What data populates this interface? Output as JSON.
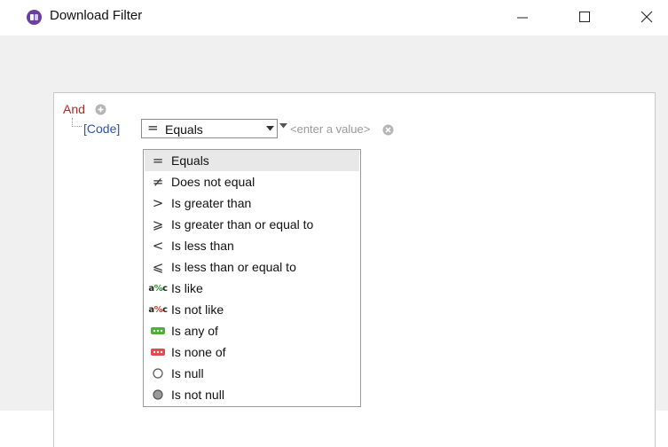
{
  "window": {
    "title": "Download Filter",
    "icon": "app-icon"
  },
  "filter": {
    "group_operator": "And",
    "field": "[Code]",
    "operator": {
      "selected_label": "Equals",
      "selected_glyph": "="
    },
    "value_placeholder": "<enter a value>"
  },
  "dropdown": {
    "items": [
      {
        "label": "Equals",
        "glyph": "=",
        "icon": "equals-icon"
      },
      {
        "label": "Does not equal",
        "glyph": "≠",
        "icon": "not-equal-icon"
      },
      {
        "label": "Is greater than",
        "glyph": ">",
        "icon": "greater-than-icon"
      },
      {
        "label": "Is greater than or equal to",
        "glyph": "⩾",
        "icon": "greater-equal-icon"
      },
      {
        "label": "Is less than",
        "glyph": "<",
        "icon": "less-than-icon"
      },
      {
        "label": "Is less than or equal to",
        "glyph": "⩽",
        "icon": "less-equal-icon"
      },
      {
        "label": "Is like",
        "glyph": "a%c",
        "icon": "like-icon"
      },
      {
        "label": "Is not like",
        "glyph": "a%c",
        "icon": "not-like-icon"
      },
      {
        "label": "Is any of",
        "glyph": "",
        "icon": "any-of-icon"
      },
      {
        "label": "Is none of",
        "glyph": "",
        "icon": "none-of-icon"
      },
      {
        "label": "Is null",
        "glyph": "",
        "icon": "null-icon"
      },
      {
        "label": "Is not null",
        "glyph": "",
        "icon": "not-null-icon"
      }
    ],
    "selected_index": 0
  },
  "colors": {
    "group_operator": "#a0302c",
    "field": "#2a55b0",
    "any_of": "#4caf3a",
    "none_of": "#e04a4a",
    "like_accent": "#2e8b2e",
    "not_like_accent": "#c0392b"
  }
}
